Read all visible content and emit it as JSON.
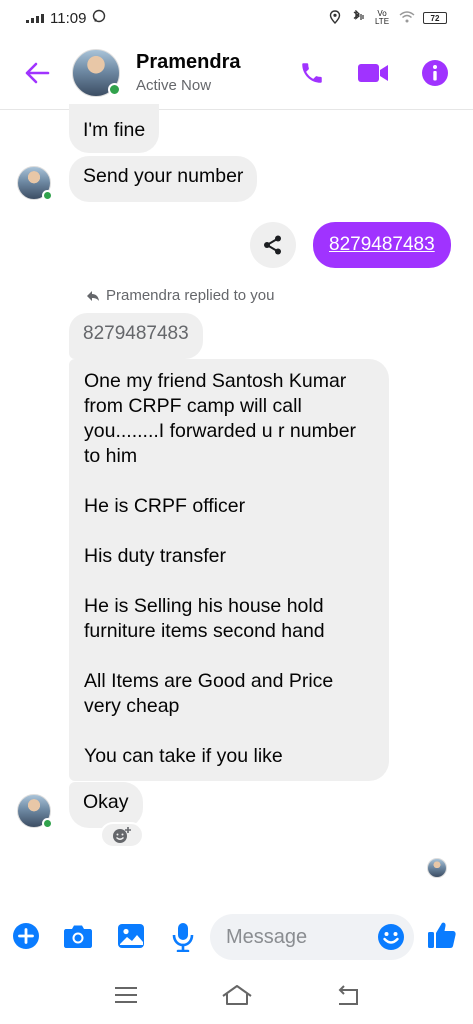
{
  "status_bar": {
    "time": "11:09",
    "volte": "Vo LTE",
    "battery": "72"
  },
  "header": {
    "name": "Pramendra",
    "status": "Active Now"
  },
  "messages": {
    "m1": "I'm fine",
    "m2": "Send your number",
    "sent_number": "8279487483",
    "reply_label": "Pramendra replied to you",
    "quoted": "8279487483",
    "long_paragraphs": [
      "One my friend Santosh Kumar from CRPF camp will call you........I forwarded u r number to him",
      "He is CRPF officer",
      "His duty transfer",
      "He is Selling his house hold furniture items second hand",
      "All Items are Good and Price very cheap",
      "You can take if you like"
    ],
    "m_okay": "Okay"
  },
  "composer": {
    "placeholder": "Message"
  },
  "colors": {
    "accent": "#a033ff",
    "blue": "#0a7cff",
    "bubble": "#efefef",
    "online": "#31a24c"
  }
}
